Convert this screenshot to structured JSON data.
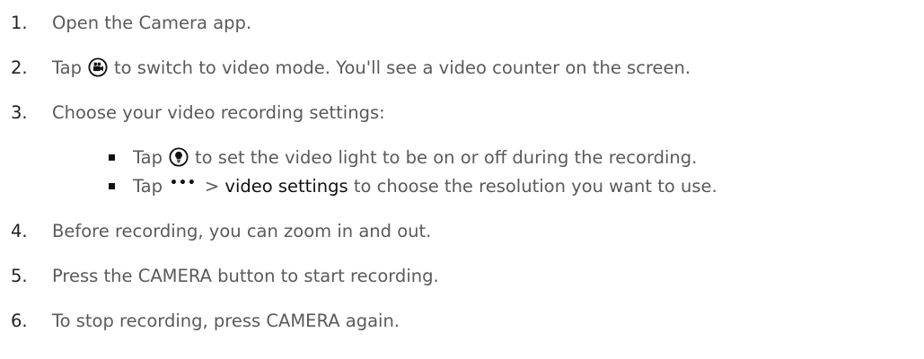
{
  "steps": [
    {
      "num": "1.",
      "text": "Open the Camera app."
    },
    {
      "num": "2.",
      "pre": "Tap",
      "icon": "video-camera-icon",
      "post": "to switch to video mode. You'll see a video counter on the screen."
    },
    {
      "num": "3.",
      "text": "Choose your video recording settings:"
    },
    {
      "num": "4.",
      "text": "Before recording, you can zoom in and out."
    },
    {
      "num": "5.",
      "text": "Press the CAMERA button to start recording."
    },
    {
      "num": "6.",
      "text": "To stop recording, press CAMERA again."
    }
  ],
  "substeps": [
    {
      "pre": "Tap",
      "icon": "video-light-icon",
      "post": "to set the video light to be on or off during the recording."
    },
    {
      "pre": "Tap",
      "icon": "more-options-icon",
      "dots": "•••",
      "mid": ">",
      "bold": "video settings",
      "post": "to choose the resolution you want to use."
    }
  ]
}
